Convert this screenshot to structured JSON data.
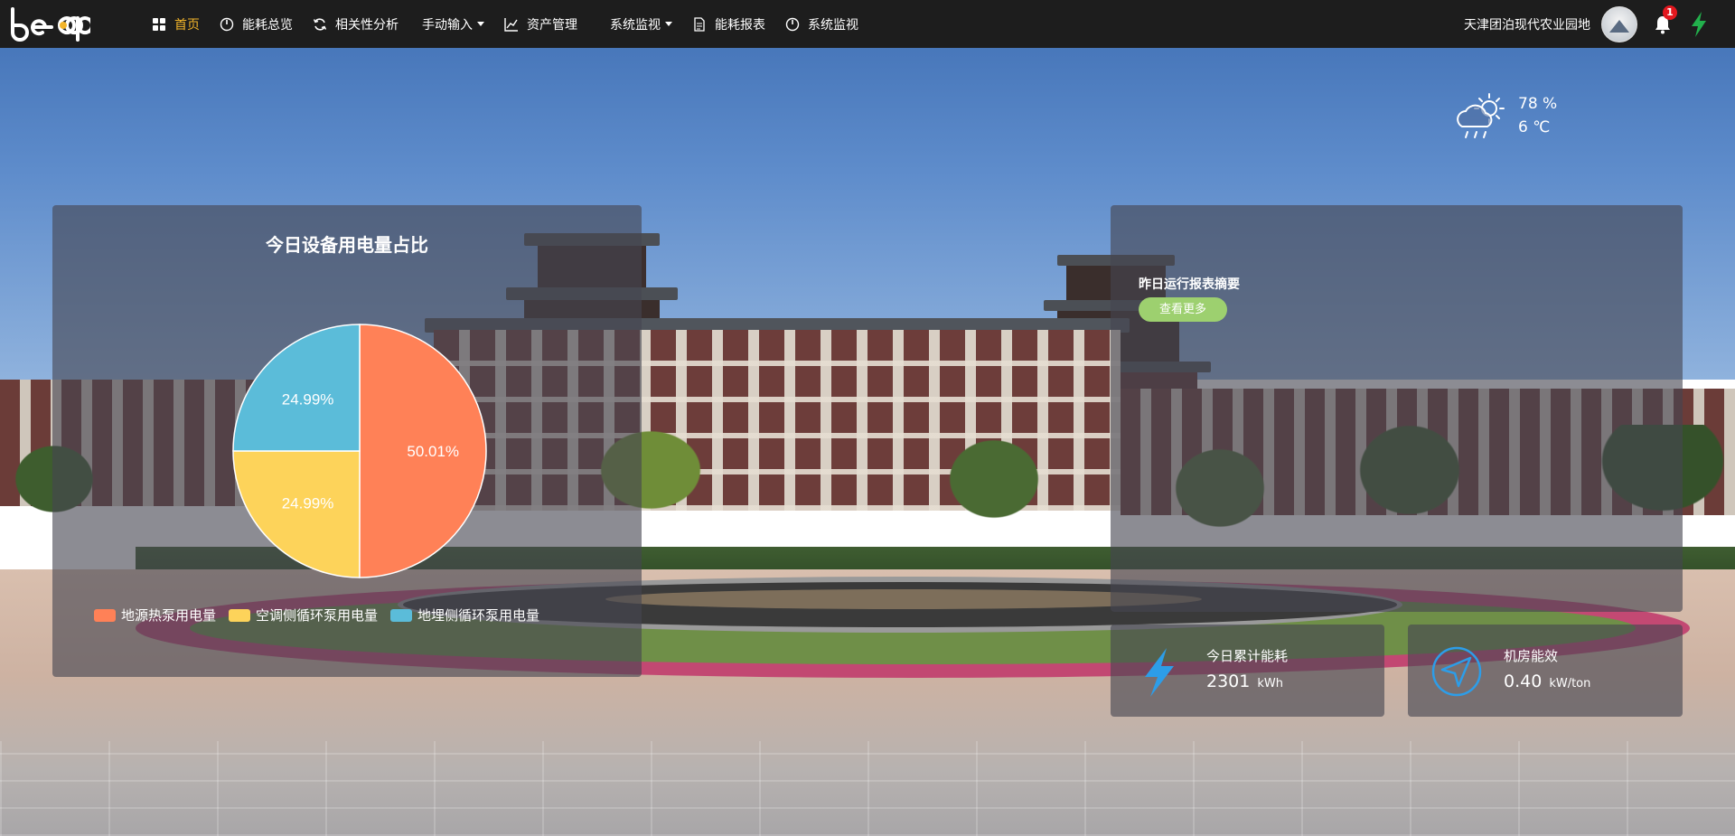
{
  "app": {
    "logo_text": "beep"
  },
  "nav": {
    "items": [
      {
        "label": "首页",
        "icon": "grid-icon",
        "active": true
      },
      {
        "label": "能耗总览",
        "icon": "dial-icon"
      },
      {
        "label": "相关性分析",
        "icon": "refresh-icon"
      },
      {
        "label": "手动输入",
        "icon": "",
        "dropdown": true
      },
      {
        "label": "资产管理",
        "icon": "line-chart-icon"
      },
      {
        "label": "系统监视",
        "icon": "",
        "dropdown": true
      },
      {
        "label": "能耗报表",
        "icon": "document-icon"
      },
      {
        "label": "系统监视",
        "icon": "dial-icon"
      }
    ]
  },
  "header": {
    "site_name": "天津团泊现代农业园地",
    "notification_count": "1"
  },
  "weather": {
    "humidity": "78 %",
    "temperature": "6 ℃"
  },
  "pie_panel": {
    "title": "今日设备用电量占比"
  },
  "chart_data": {
    "type": "pie",
    "title": "今日设备用电量占比",
    "labels": [
      "地源热泵用电量",
      "空调侧循环泵用电量",
      "地埋侧循环泵用电量"
    ],
    "values": [
      50.01,
      24.99,
      24.99
    ],
    "value_labels": [
      "50.01%",
      "24.99%",
      "24.99%"
    ],
    "colors": [
      "#ff8157",
      "#fdd35a",
      "#5bbcd9"
    ],
    "legend_position": "bottom-left"
  },
  "report": {
    "title": "昨日运行报表摘要",
    "more_button": "查看更多"
  },
  "stats": {
    "today_energy": {
      "label": "今日累计能耗",
      "value": "2301",
      "unit": "kWh"
    },
    "room_efficiency": {
      "label": "机房能效",
      "value": "0.40",
      "unit": "kW/ton"
    }
  },
  "colors": {
    "nav_bg": "#1d1d1d",
    "active_nav": "#f3b52a",
    "button_green": "#9dd06f",
    "icon_blue": "#2d9de8"
  }
}
